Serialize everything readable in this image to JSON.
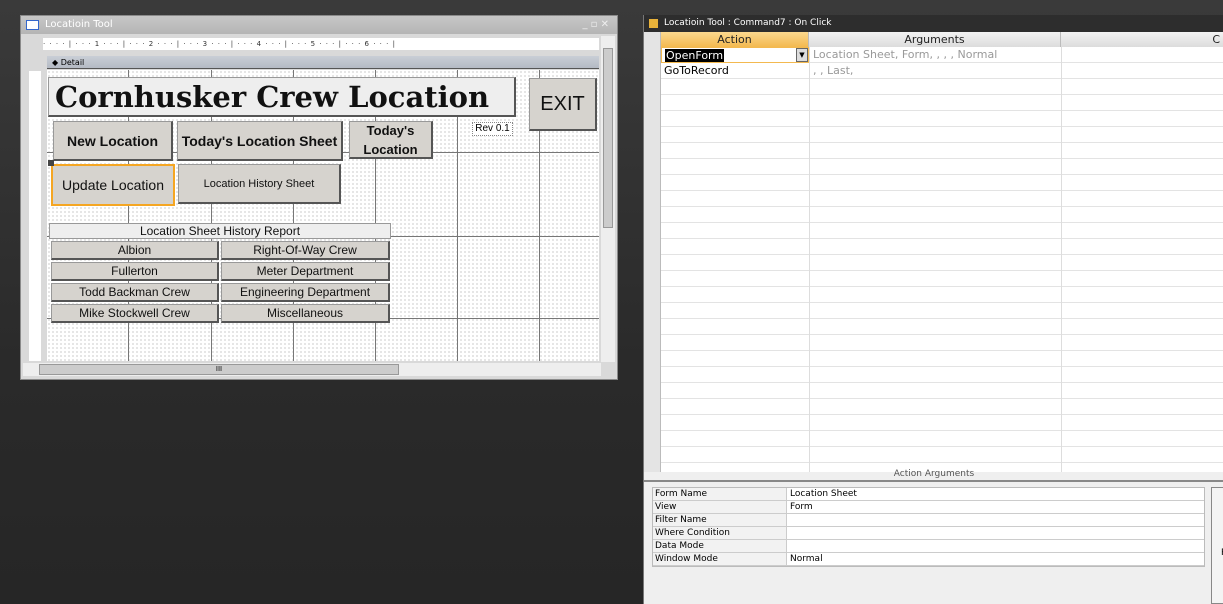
{
  "form_window": {
    "title": "Locatioin Tool",
    "ruler": "· · · · | · · · 1 · · · | · · · 2 · · · | · · · 3 · · · | · · · 4 · · · | · · · 5 · · · | · · · 6 · · · |",
    "section": "Detail",
    "title_label": "Cornhusker Crew Location",
    "exit": "EXIT",
    "new_location": "New Location",
    "todays_sheet": "Today's Location Sheet",
    "todays_location": "Today's Location",
    "rev": "Rev 0.1",
    "update_location": "Update Location",
    "history_sheet": "Location History Sheet",
    "report_label": "Location Sheet History Report",
    "report_buttons": [
      "Albion",
      "Right-Of-Way Crew",
      "Fullerton",
      "Meter Department",
      "Todd Backman Crew",
      "Engineering Department",
      "Mike Stockwell Crew",
      "Miscellaneous"
    ],
    "scroll_thumb": "III"
  },
  "macro_window": {
    "title": "Locatioin Tool : Command7 : On Click",
    "columns": [
      "Action",
      "Arguments",
      "C"
    ],
    "rows": [
      {
        "action": "OpenForm",
        "arguments": "Location Sheet, Form, , , , Normal"
      },
      {
        "action": "GoToRecord",
        "arguments": ", , Last,"
      }
    ],
    "action_arguments_label": "Action Arguments",
    "arguments": [
      {
        "label": "Form Name",
        "value": "Location Sheet"
      },
      {
        "label": "View",
        "value": "Form"
      },
      {
        "label": "Filter Name",
        "value": ""
      },
      {
        "label": "Where Condition",
        "value": ""
      },
      {
        "label": "Data Mode",
        "value": ""
      },
      {
        "label": "Window Mode",
        "value": "Normal"
      }
    ],
    "help_fragment": [
      "C",
      "Pr"
    ]
  },
  "colors": {
    "selection": "#f5a623",
    "accent_header": "#f6c56b"
  }
}
